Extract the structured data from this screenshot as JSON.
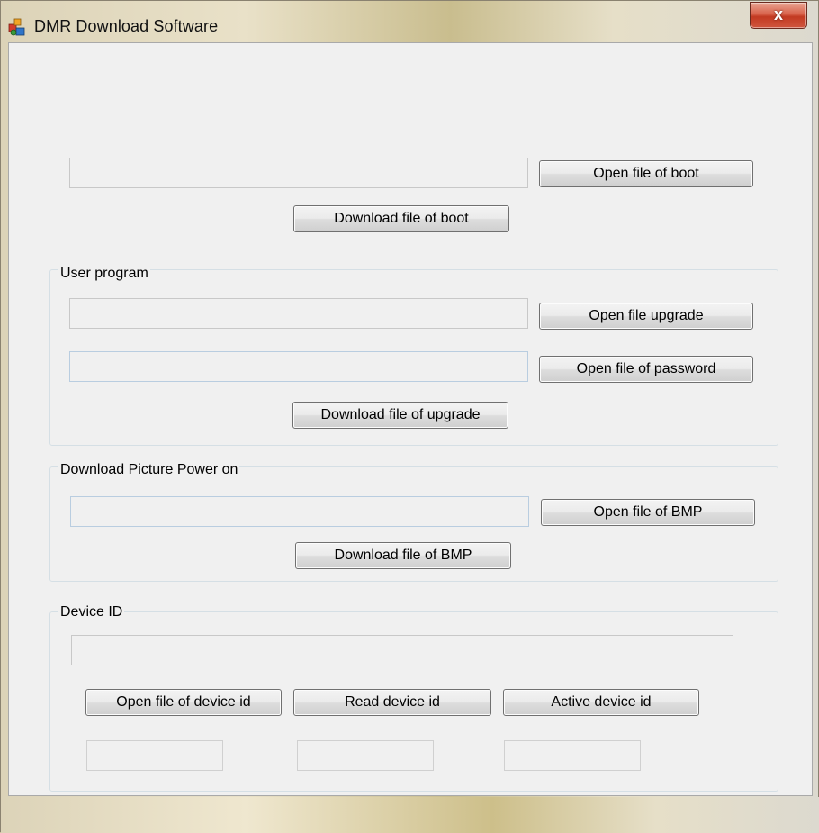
{
  "window": {
    "title": "DMR Download Software",
    "close_glyph": "x",
    "app_icon": "colorful-app-icon"
  },
  "boot": {
    "path_value": "",
    "open_label": "Open file of boot",
    "download_label": "Download file of boot"
  },
  "user_program": {
    "group_label": "User program",
    "upgrade_path_value": "",
    "open_upgrade_label": "Open file upgrade",
    "password_path_value": "",
    "open_password_label": "Open file of password",
    "download_label": "Download file of upgrade"
  },
  "picture": {
    "group_label": "Download Picture Power on",
    "bmp_path_value": "",
    "open_label": "Open file of BMP",
    "download_label": "Download file of BMP"
  },
  "device": {
    "group_label": "Device ID",
    "id_value": "",
    "open_label": "Open file of device id",
    "read_label": "Read device id",
    "active_label": "Active device id",
    "readout_1": "",
    "readout_2": "",
    "readout_3": ""
  },
  "colors": {
    "client_background": "#f0f0f0",
    "close_button": "#c23a22",
    "group_border": "#d5dfe5"
  }
}
